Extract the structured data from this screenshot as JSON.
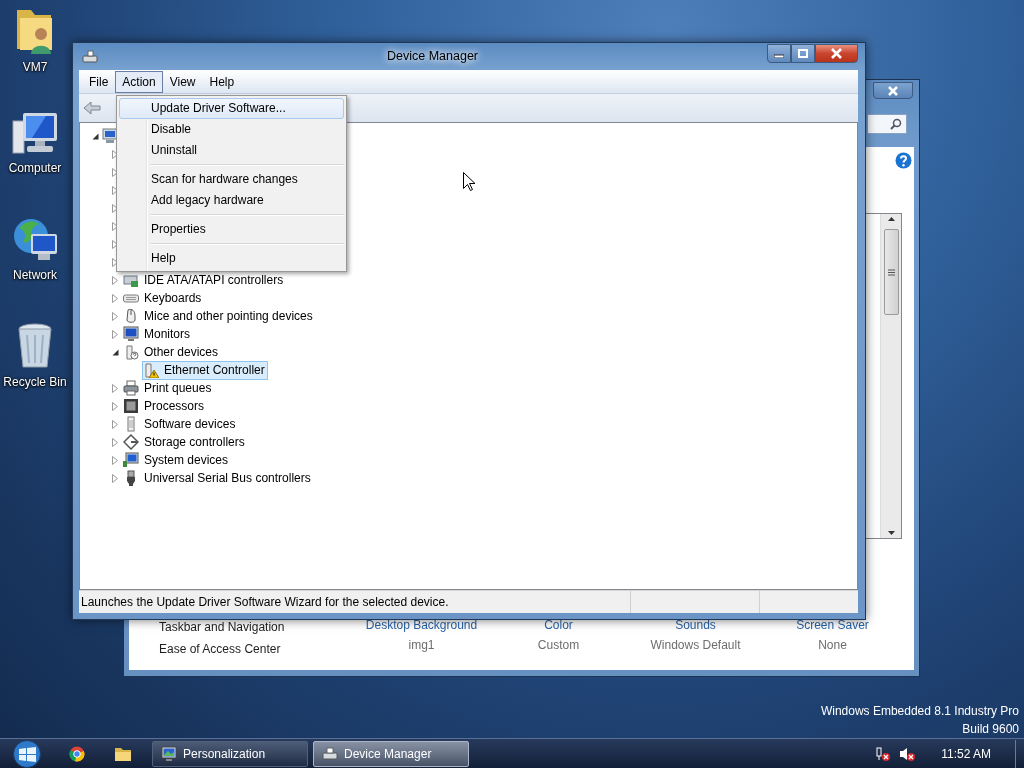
{
  "desktop": {
    "icons": [
      {
        "label": "VM7",
        "kind": "user-folder"
      },
      {
        "label": "Computer",
        "kind": "computer"
      },
      {
        "label": "Network",
        "kind": "network"
      },
      {
        "label": "Recycle Bin",
        "kind": "recycle"
      }
    ],
    "edition": "Windows Embedded 8.1 Industry Pro",
    "build": "Build 9600"
  },
  "personalization_window": {
    "see_also": [
      "Taskbar and Navigation",
      "Ease of Access Center"
    ],
    "theme_settings": [
      {
        "label": "Desktop Background",
        "value": "img1"
      },
      {
        "label": "Color",
        "value": "Custom"
      },
      {
        "label": "Sounds",
        "value": "Windows Default"
      },
      {
        "label": "Screen Saver",
        "value": "None"
      }
    ]
  },
  "device_manager": {
    "title": "Device Manager",
    "menu_bar": [
      {
        "label": "File",
        "selected": false
      },
      {
        "label": "Action",
        "selected": true
      },
      {
        "label": "View",
        "selected": false
      },
      {
        "label": "Help",
        "selected": false
      }
    ],
    "action_menu": [
      {
        "kind": "item",
        "label": "Update Driver Software...",
        "selected": true
      },
      {
        "kind": "item",
        "label": "Disable",
        "selected": false
      },
      {
        "kind": "item",
        "label": "Uninstall",
        "selected": false
      },
      {
        "kind": "separator"
      },
      {
        "kind": "item",
        "label": "Scan for hardware changes",
        "selected": false
      },
      {
        "kind": "item",
        "label": "Add legacy hardware",
        "selected": false
      },
      {
        "kind": "separator"
      },
      {
        "kind": "item",
        "label": "Properties",
        "selected": false
      },
      {
        "kind": "separator"
      },
      {
        "kind": "item",
        "label": "Help",
        "selected": false
      }
    ],
    "tree": [
      {
        "kind": "computer",
        "expanded": true,
        "children": [
          {
            "expanded": false
          },
          {
            "expanded": false
          },
          {
            "expanded": false
          },
          {
            "expanded": false
          },
          {
            "expanded": false
          },
          {
            "expanded": false
          },
          {
            "expanded": false
          },
          {
            "kind": "ide",
            "label": "IDE ATA/ATAPI controllers",
            "expanded": false,
            "selected": false
          },
          {
            "kind": "keyboard",
            "label": "Keyboards",
            "expanded": false,
            "selected": false
          },
          {
            "kind": "mouse",
            "label": "Mice and other pointing devices",
            "expanded": false,
            "selected": false
          },
          {
            "kind": "monitor",
            "label": "Monitors",
            "expanded": false,
            "selected": false
          },
          {
            "kind": "unknown",
            "label": "Other devices",
            "expanded": true,
            "selected": false,
            "children": [
              {
                "kind": "device",
                "label": "Ethernet Controller",
                "selected": true,
                "warning": true
              }
            ]
          },
          {
            "kind": "printer",
            "label": "Print queues",
            "expanded": false,
            "selected": false
          },
          {
            "kind": "chip",
            "label": "Processors",
            "expanded": false,
            "selected": false
          },
          {
            "kind": "software",
            "label": "Software devices",
            "expanded": false,
            "selected": false
          },
          {
            "kind": "storage",
            "label": "Storage controllers",
            "expanded": false,
            "selected": false
          },
          {
            "kind": "system",
            "label": "System devices",
            "expanded": false,
            "selected": false
          },
          {
            "kind": "usb",
            "label": "Universal Serial Bus controllers",
            "expanded": false,
            "selected": false
          }
        ]
      }
    ],
    "status_bar": "Launches the Update Driver Software Wizard for the selected device."
  },
  "taskbar": {
    "tasks": [
      {
        "label": "Personalization",
        "kind": "personalization",
        "selected": false
      },
      {
        "label": "Device Manager",
        "kind": "device-manager",
        "selected": true
      }
    ],
    "clock": "11:52 AM"
  }
}
